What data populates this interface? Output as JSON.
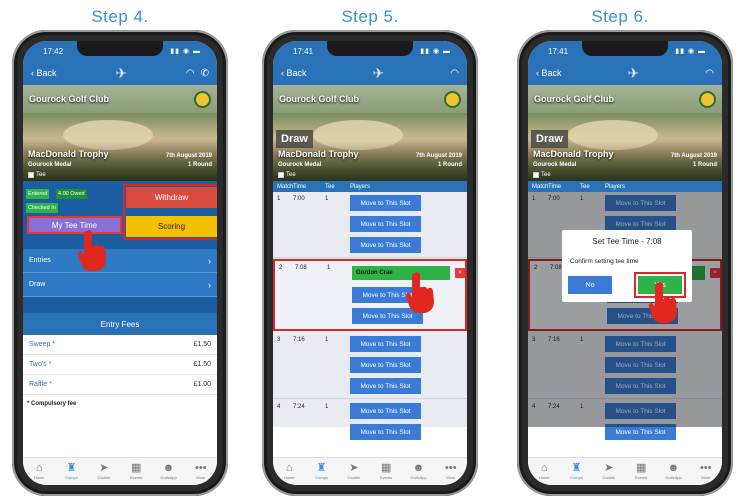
{
  "steps": [
    {
      "title": "Step 4."
    },
    {
      "title": "Step 5."
    },
    {
      "title": "Step 6."
    }
  ],
  "status": {
    "time4": "17:42",
    "time5": "17:41",
    "time6": "17:41"
  },
  "nav": {
    "back": "Back"
  },
  "club": {
    "name": "Gourock Golf Club"
  },
  "draw_label": "Draw",
  "competition": {
    "name": "MacDonald Trophy",
    "subtitle": "Gourock Medal",
    "tee": "Tee",
    "date": "7th August 2019",
    "rounds": "1 Round"
  },
  "step4": {
    "badge_entered": "Entered",
    "badge_owed": "4.00 Owed",
    "badge_checked": "Checked In",
    "withdraw": "Withdraw",
    "my_tee_time": "My Tee Time",
    "scoring": "Scoring",
    "entries": "Entries",
    "draw": "Draw",
    "fees_header": "Entry Fees",
    "fees": [
      {
        "name": "Sweep *",
        "amount": "£1.50"
      },
      {
        "name": "Two's *",
        "amount": "£1.50"
      },
      {
        "name": "Raffle *",
        "amount": "£1.00"
      }
    ],
    "compulsory": "* Compulsory fee"
  },
  "table_headers": {
    "match": "Match",
    "time": "Time",
    "tee": "Tee",
    "players": "Players"
  },
  "slots": {
    "s1": {
      "num": "1",
      "time": "7:00",
      "tee": "1"
    },
    "s2": {
      "num": "2",
      "time": "7:08",
      "tee": "1"
    },
    "s3": {
      "num": "3",
      "time": "7:16",
      "tee": "1"
    },
    "s4": {
      "num": "4",
      "time": "7:24",
      "tee": "1"
    }
  },
  "move_label": "Move to This Slot",
  "player_name": "Gordon Crae",
  "remove_label": "×",
  "dialog": {
    "title": "Set Tee Time - 7:08",
    "message": "Confirm setting tee time",
    "no": "No",
    "yes": "Yes"
  },
  "tabs": [
    {
      "label": "Home",
      "icon": "home-icon"
    },
    {
      "label": "Comps",
      "icon": "trophy-icon"
    },
    {
      "label": "Caddie",
      "icon": "navigation-arrow-icon"
    },
    {
      "label": "Events",
      "icon": "calendar-icon"
    },
    {
      "label": "GolfsApp",
      "icon": "people-icon"
    },
    {
      "label": "More",
      "icon": "more-dots-icon"
    }
  ],
  "colors": {
    "primary": "#2a72b8",
    "accent": "#3a8fd8",
    "highlight": "#d42a2a",
    "green": "#2fb349",
    "red": "#d94a3f",
    "yellow": "#f4c100",
    "purple": "#8a6fd6"
  }
}
